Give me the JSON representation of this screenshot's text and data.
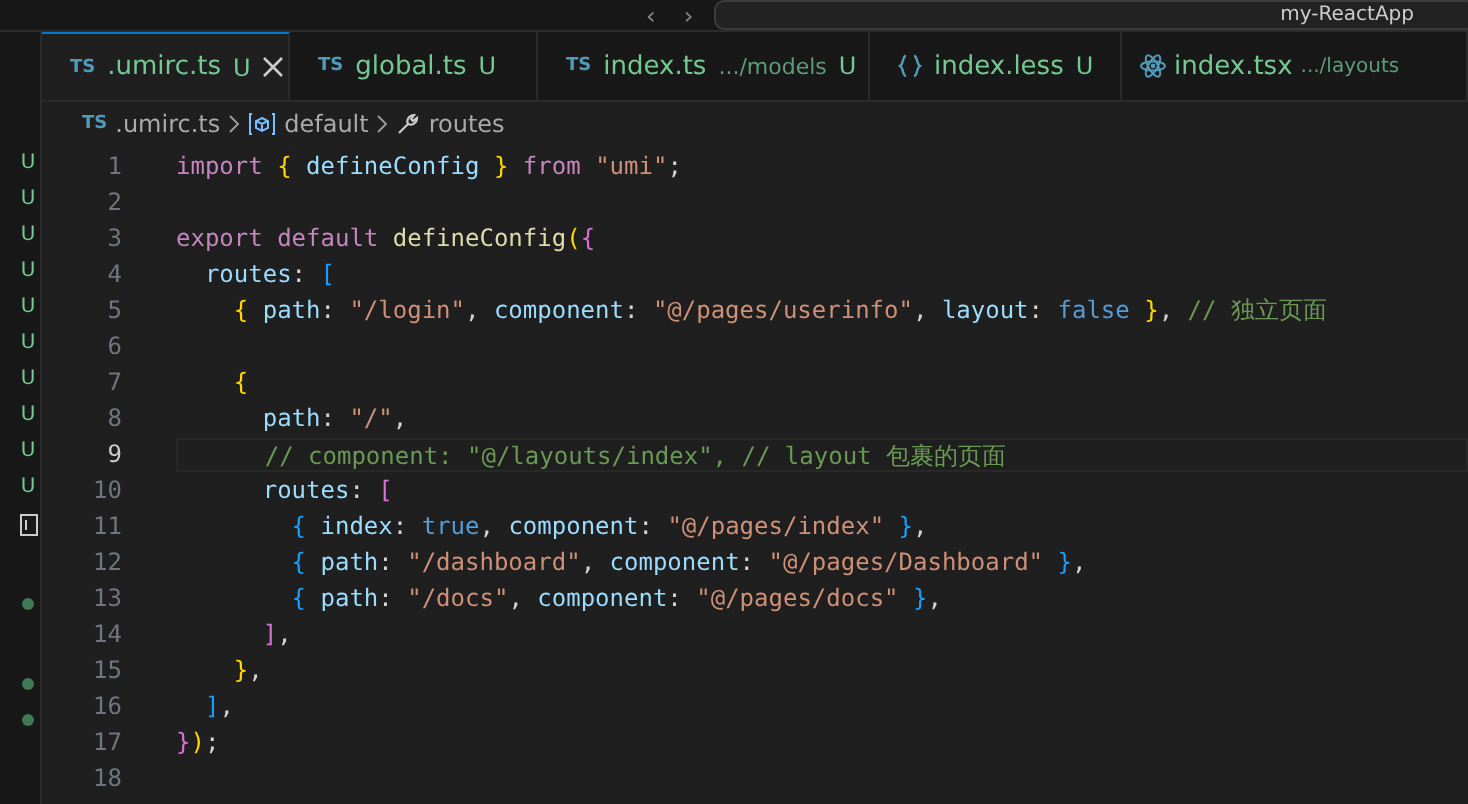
{
  "title_bar": {
    "back": "‹",
    "forward": "›",
    "search": "my-ReactApp"
  },
  "sidebar": {
    "items": [
      {
        "kind": "u",
        "text": "U"
      },
      {
        "kind": "u",
        "text": "U"
      },
      {
        "kind": "u",
        "text": "U"
      },
      {
        "kind": "u",
        "text": "U"
      },
      {
        "kind": "u",
        "text": "U"
      },
      {
        "kind": "u",
        "text": "U"
      },
      {
        "kind": "u",
        "text": "U"
      },
      {
        "kind": "u",
        "text": "U"
      },
      {
        "kind": "u",
        "text": "U"
      },
      {
        "kind": "u",
        "text": "U"
      },
      {
        "kind": "icon"
      },
      {
        "kind": "gap"
      },
      {
        "kind": "dot"
      },
      {
        "kind": "gap"
      },
      {
        "kind": "dot"
      },
      {
        "kind": "dot"
      }
    ]
  },
  "tabs": [
    {
      "kind": "ts",
      "badge": "TS",
      "label": ".umirc.ts",
      "status": "U",
      "selected": true
    },
    {
      "kind": "ts",
      "badge": "TS",
      "label": "global.ts",
      "status": "U",
      "selected": false
    },
    {
      "kind": "ts",
      "badge": "TS",
      "label": "index.ts",
      "path": ".../models",
      "status": "U",
      "selected": false
    },
    {
      "kind": "less",
      "label": "index.less",
      "status": "U",
      "selected": false
    },
    {
      "kind": "tsx",
      "label": "index.tsx",
      "path": ".../layouts",
      "selected": false
    }
  ],
  "breadcrumb": [
    {
      "kind": "ts",
      "badge": "TS",
      "label": ".umirc.ts"
    },
    {
      "kind": "module",
      "label": "default"
    },
    {
      "kind": "property",
      "label": "routes"
    }
  ],
  "editor": {
    "lines": [
      {
        "number": "1",
        "current": false,
        "tokens": [
          {
            "kind": "kw",
            "t": "import "
          },
          {
            "kind": "b1",
            "t": "{"
          },
          {
            "kind": "prop",
            "t": " defineConfig "
          },
          {
            "kind": "b1",
            "t": "}"
          },
          {
            "kind": "kw",
            "t": " from "
          },
          {
            "kind": "str",
            "t": "\"umi\""
          },
          {
            "kind": "p",
            "t": ";"
          }
        ]
      },
      {
        "number": "2",
        "current": false
      },
      {
        "number": "3",
        "current": false,
        "tokens": [
          {
            "kind": "kw",
            "t": "export default "
          },
          {
            "kind": "fn",
            "t": "defineConfig"
          },
          {
            "kind": "b1",
            "t": "("
          },
          {
            "kind": "b2",
            "t": "{"
          }
        ]
      },
      {
        "number": "4",
        "current": false,
        "tokens": [
          {
            "kind": "prop",
            "t": "  routes"
          },
          {
            "kind": "p",
            "t": ": "
          },
          {
            "kind": "b3",
            "t": "["
          }
        ]
      },
      {
        "number": "5",
        "current": false,
        "tokens": [
          {
            "kind": "b1",
            "t": "    {"
          },
          {
            "kind": "prop",
            "t": " path"
          },
          {
            "kind": "p",
            "t": ": "
          },
          {
            "kind": "str",
            "t": "\"/login\""
          },
          {
            "kind": "p",
            "t": ", "
          },
          {
            "kind": "prop",
            "t": "component"
          },
          {
            "kind": "p",
            "t": ": "
          },
          {
            "kind": "str",
            "t": "\"@/pages/userinfo\""
          },
          {
            "kind": "p",
            "t": ", "
          },
          {
            "kind": "prop",
            "t": "layout"
          },
          {
            "kind": "p",
            "t": ": "
          },
          {
            "kind": "bool",
            "t": "false "
          },
          {
            "kind": "b1",
            "t": "}"
          },
          {
            "kind": "p",
            "t": ", "
          },
          {
            "kind": "cmt",
            "t": "// 独立页面"
          }
        ]
      },
      {
        "number": "6",
        "current": false
      },
      {
        "number": "7",
        "current": false,
        "tokens": [
          {
            "kind": "b1",
            "t": "    {"
          }
        ]
      },
      {
        "number": "8",
        "current": false,
        "tokens": [
          {
            "kind": "prop",
            "t": "      path"
          },
          {
            "kind": "p",
            "t": ": "
          },
          {
            "kind": "str",
            "t": "\"/\""
          },
          {
            "kind": "p",
            "t": ","
          }
        ]
      },
      {
        "number": "9",
        "current": true,
        "tokens": [
          {
            "kind": "cmt",
            "t": "      // component: \"@/layouts/index\", // layout 包裹的页面"
          }
        ]
      },
      {
        "number": "10",
        "current": false,
        "tokens": [
          {
            "kind": "prop",
            "t": "      routes"
          },
          {
            "kind": "p",
            "t": ": "
          },
          {
            "kind": "b2",
            "t": "["
          }
        ]
      },
      {
        "number": "11",
        "current": false,
        "tokens": [
          {
            "kind": "b3",
            "t": "        {"
          },
          {
            "kind": "prop",
            "t": " index"
          },
          {
            "kind": "p",
            "t": ": "
          },
          {
            "kind": "bool",
            "t": "true"
          },
          {
            "kind": "p",
            "t": ", "
          },
          {
            "kind": "prop",
            "t": "component"
          },
          {
            "kind": "p",
            "t": ": "
          },
          {
            "kind": "str",
            "t": "\"@/pages/index\" "
          },
          {
            "kind": "b3",
            "t": "}"
          },
          {
            "kind": "p",
            "t": ","
          }
        ]
      },
      {
        "number": "12",
        "current": false,
        "tokens": [
          {
            "kind": "b3",
            "t": "        {"
          },
          {
            "kind": "prop",
            "t": " path"
          },
          {
            "kind": "p",
            "t": ": "
          },
          {
            "kind": "str",
            "t": "\"/dashboard\""
          },
          {
            "kind": "p",
            "t": ", "
          },
          {
            "kind": "prop",
            "t": "component"
          },
          {
            "kind": "p",
            "t": ": "
          },
          {
            "kind": "str",
            "t": "\"@/pages/Dashboard\" "
          },
          {
            "kind": "b3",
            "t": "}"
          },
          {
            "kind": "p",
            "t": ","
          }
        ]
      },
      {
        "number": "13",
        "current": false,
        "tokens": [
          {
            "kind": "b3",
            "t": "        {"
          },
          {
            "kind": "prop",
            "t": " path"
          },
          {
            "kind": "p",
            "t": ": "
          },
          {
            "kind": "str",
            "t": "\"/docs\""
          },
          {
            "kind": "p",
            "t": ", "
          },
          {
            "kind": "prop",
            "t": "component"
          },
          {
            "kind": "p",
            "t": ": "
          },
          {
            "kind": "str",
            "t": "\"@/pages/docs\" "
          },
          {
            "kind": "b3",
            "t": "}"
          },
          {
            "kind": "p",
            "t": ","
          }
        ]
      },
      {
        "number": "14",
        "current": false,
        "tokens": [
          {
            "kind": "b2",
            "t": "      ]"
          },
          {
            "kind": "p",
            "t": ","
          }
        ]
      },
      {
        "number": "15",
        "current": false,
        "tokens": [
          {
            "kind": "b1",
            "t": "    }"
          },
          {
            "kind": "p",
            "t": ","
          }
        ]
      },
      {
        "number": "16",
        "current": false,
        "tokens": [
          {
            "kind": "b3",
            "t": "  ]"
          },
          {
            "kind": "p",
            "t": ","
          }
        ]
      },
      {
        "number": "17",
        "current": false,
        "tokens": [
          {
            "kind": "b2",
            "t": "}"
          },
          {
            "kind": "b1",
            "t": ")"
          },
          {
            "kind": "p",
            "t": ";"
          }
        ]
      },
      {
        "number": "18",
        "current": false
      }
    ]
  }
}
